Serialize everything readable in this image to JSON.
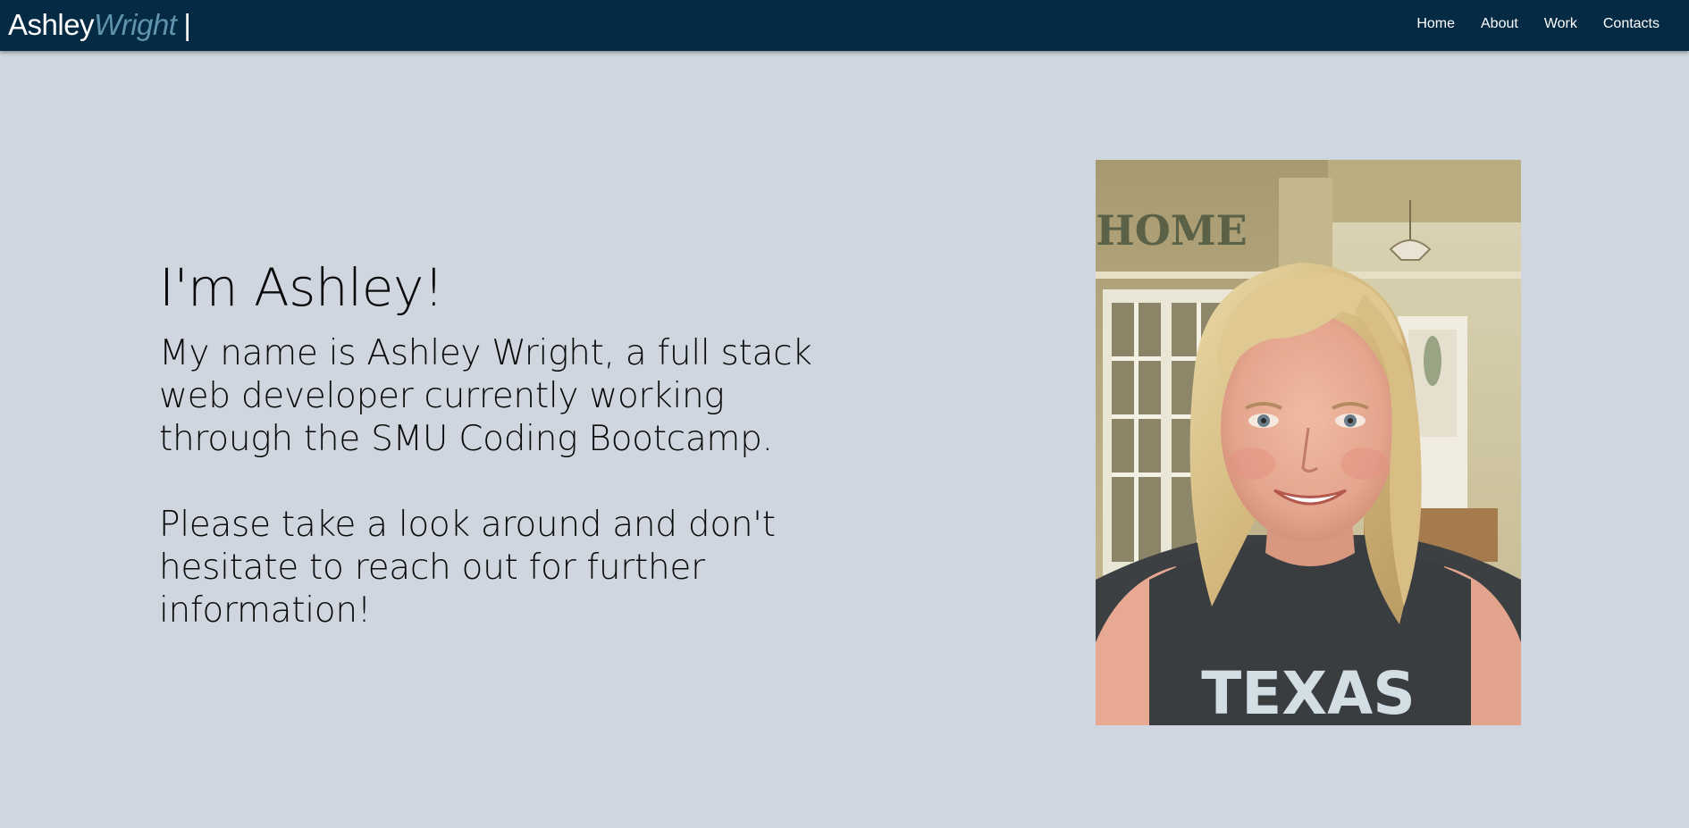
{
  "header": {
    "brand_first": "Ashley",
    "brand_last": "Wright",
    "brand_separator": "|",
    "nav": [
      {
        "label": "Home"
      },
      {
        "label": "About"
      },
      {
        "label": "Work"
      },
      {
        "label": "Contacts"
      }
    ]
  },
  "intro": {
    "heading": "I'm Ashley!",
    "bio": "My name is Ashley Wright, a full stack web developer currently working through the SMU Coding Bootcamp.",
    "cta": "Please take a look around and don't hesitate to reach out for further information!"
  },
  "photo": {
    "sign_text": "HOME",
    "shirt_text": "TEXAS"
  },
  "colors": {
    "navbar": "#052a43",
    "page_background": "#cfd6e0",
    "brand_accent": "#5f93ae",
    "nav_text": "#ffffff"
  }
}
